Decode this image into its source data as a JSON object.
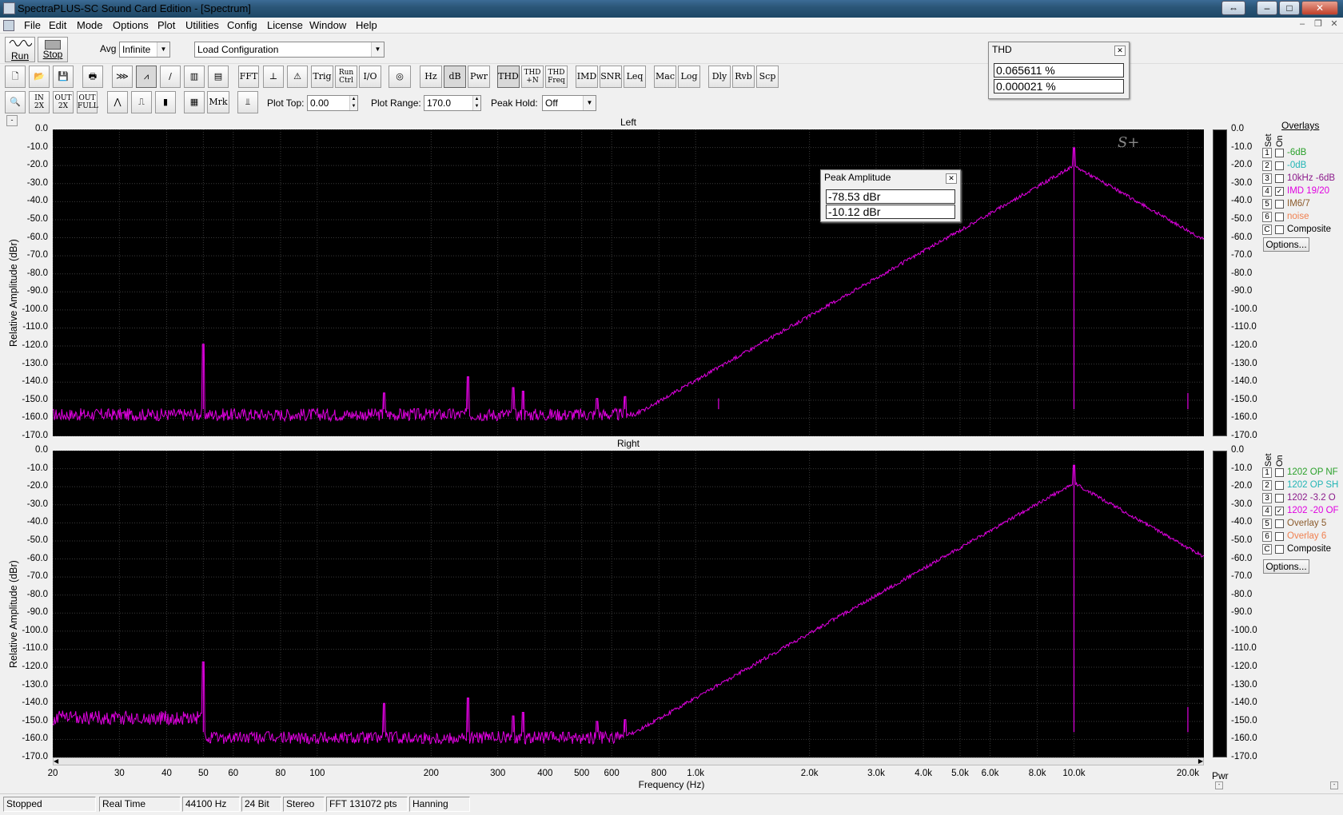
{
  "window": {
    "title": "SpectraPLUS-SC Sound Card Edition - [Spectrum]"
  },
  "menu": [
    "File",
    "Edit",
    "Mode",
    "Options",
    "Plot",
    "Utilities",
    "Config",
    "License",
    "Window",
    "Help"
  ],
  "toolbar1": {
    "run_label": "Run",
    "stop_label": "Stop",
    "avg_label": "Avg",
    "avg_value": "Infinite",
    "config_value": "Load Configuration"
  },
  "toolbar2": [
    "FFT",
    "Trig",
    "Run Ctrl",
    "I/O",
    "Hz",
    "dB",
    "Pwr",
    "THD",
    "THD +N",
    "THD Freq",
    "IMD",
    "SNR",
    "Leq",
    "Mac",
    "Log",
    "Dly",
    "Rvb",
    "Scp"
  ],
  "toolbar3": {
    "zoom_in_2x": "IN 2X",
    "zoom_out_2x": "OUT 2X",
    "zoom_out_full": "OUT FULL",
    "marker": "Mrk",
    "plot_top_label": "Plot Top:",
    "plot_top_value": "0.00",
    "plot_range_label": "Plot Range:",
    "plot_range_value": "170.0",
    "peak_hold_label": "Peak Hold:",
    "peak_hold_value": "Off"
  },
  "thd_window": {
    "title": "THD",
    "value1": "0.065611 %",
    "value2": "0.000021 %"
  },
  "peak_window": {
    "title": "Peak Amplitude",
    "value1": "-78.53 dBr",
    "value2": "-10.12 dBr"
  },
  "overlays_left": {
    "header": "Overlays",
    "col_set": "Set",
    "col_on": "On",
    "items": [
      {
        "num": "1",
        "label": "-6dB",
        "color": "#2aa02a",
        "checked": false
      },
      {
        "num": "2",
        "label": "-0dB",
        "color": "#22b5b5",
        "checked": false
      },
      {
        "num": "3",
        "label": "10kHz -6dB",
        "color": "#8b1a8b",
        "checked": false
      },
      {
        "num": "4",
        "label": "IMD 19/20",
        "color": "#e000e0",
        "checked": true
      },
      {
        "num": "5",
        "label": "IM6/7",
        "color": "#8b5a2b",
        "checked": false
      },
      {
        "num": "6",
        "label": "noise",
        "color": "#f08050",
        "checked": false
      },
      {
        "num": "C",
        "label": "Composite",
        "color": "#000000",
        "checked": false
      }
    ],
    "options": "Options..."
  },
  "overlays_right": {
    "col_set": "Set",
    "col_on": "On",
    "items": [
      {
        "num": "1",
        "label": "1202 OP NF",
        "color": "#2aa02a",
        "checked": false
      },
      {
        "num": "2",
        "label": "1202 OP SH",
        "color": "#22b5b5",
        "checked": false
      },
      {
        "num": "3",
        "label": "1202 -3.2 O",
        "color": "#8b1a8b",
        "checked": false
      },
      {
        "num": "4",
        "label": "1202 -20 OF",
        "color": "#e000e0",
        "checked": true
      },
      {
        "num": "5",
        "label": "Overlay 5",
        "color": "#8b5a2b",
        "checked": false
      },
      {
        "num": "6",
        "label": "Overlay 6",
        "color": "#f08050",
        "checked": false
      },
      {
        "num": "C",
        "label": "Composite",
        "color": "#000000",
        "checked": false
      }
    ],
    "options": "Options..."
  },
  "axes": {
    "ylabel": "Relative Amplitude (dBr)",
    "xlabel": "Frequency (Hz)",
    "pwr_label": "Pwr",
    "yticks": [
      "0.0",
      "-10.0",
      "-20.0",
      "-30.0",
      "-40.0",
      "-50.0",
      "-60.0",
      "-70.0",
      "-80.0",
      "-90.0",
      "-100.0",
      "-110.0",
      "-120.0",
      "-130.0",
      "-140.0",
      "-150.0",
      "-160.0",
      "-170.0"
    ],
    "xticks": [
      "20",
      "30",
      "40",
      "50",
      "60",
      "80",
      "100",
      "200",
      "300",
      "400",
      "500",
      "600",
      "800",
      "1.0k",
      "2.0k",
      "3.0k",
      "4.0k",
      "5.0k",
      "6.0k",
      "8.0k",
      "10.0k",
      "20.0k"
    ]
  },
  "chart_data": [
    {
      "type": "line",
      "title": "Left",
      "xlabel": "Frequency (Hz)",
      "ylabel": "Relative Amplitude (dBr)",
      "xscale": "log",
      "xlim": [
        20,
        22050
      ],
      "ylim": [
        -170,
        0
      ],
      "grid": true,
      "line_color": "#e000e0",
      "noise_floor_dBr": -155,
      "peaks": [
        {
          "x": 50,
          "y": -119
        },
        {
          "x": 150,
          "y": -146
        },
        {
          "x": 250,
          "y": -137
        },
        {
          "x": 330,
          "y": -143
        },
        {
          "x": 350,
          "y": -145
        },
        {
          "x": 550,
          "y": -149
        },
        {
          "x": 650,
          "y": -148
        },
        {
          "x": 1150,
          "y": -149
        },
        {
          "x": 10000,
          "y": -10.12
        },
        {
          "x": 20000,
          "y": -146
        }
      ]
    },
    {
      "type": "line",
      "title": "Right",
      "xlabel": "Frequency (Hz)",
      "ylabel": "Relative Amplitude (dBr)",
      "xscale": "log",
      "xlim": [
        20,
        22050
      ],
      "ylim": [
        -170,
        0
      ],
      "grid": true,
      "line_color": "#e000e0",
      "noise_floor_dBr": -156,
      "peaks": [
        {
          "x": 50,
          "y": -117
        },
        {
          "x": 150,
          "y": -140
        },
        {
          "x": 250,
          "y": -137
        },
        {
          "x": 330,
          "y": -147
        },
        {
          "x": 350,
          "y": -145
        },
        {
          "x": 550,
          "y": -150
        },
        {
          "x": 650,
          "y": -149
        },
        {
          "x": 10000,
          "y": -8
        },
        {
          "x": 20000,
          "y": -142
        }
      ]
    }
  ],
  "status": {
    "state": "Stopped",
    "mode": "Real Time",
    "rate": "44100 Hz",
    "bits": "24 Bit",
    "channels": "Stereo",
    "fft": "FFT 131072 pts",
    "window": "Hanning"
  }
}
